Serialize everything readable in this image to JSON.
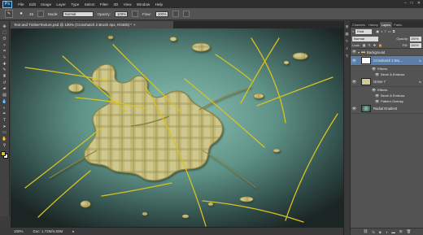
{
  "app": {
    "logo": "Ps"
  },
  "menu": [
    "File",
    "Edit",
    "Image",
    "Layer",
    "Type",
    "Select",
    "Filter",
    "3D",
    "View",
    "Window",
    "Help"
  ],
  "window_controls": [
    "–",
    "□",
    "✕"
  ],
  "options_bar": {
    "brush_size": "45",
    "mode_label": "Mode:",
    "mode_value": "Normal",
    "opacity_label": "Opacity:",
    "opacity_value": "100%",
    "flow_label": "Flow:",
    "flow_value": "100%"
  },
  "document": {
    "tab_title": "Text and TimberTexture.psd @ 100% (Crosshatch 2 Brush 4px, RGB/8) *",
    "close": "×",
    "zoom": "100%",
    "doc_size": "Doc: 1.72M/4.83M"
  },
  "colors": {
    "canvas_bg": "#5a8a82",
    "splatter": "#b8b06a",
    "lines": "#d8c220",
    "foreground_swatch": "#d8c220",
    "background_swatch": "#ffffff",
    "selection": "#5c7ea8"
  },
  "layers_panel": {
    "tabs": [
      "Channels",
      "History",
      "Layers",
      "Paths"
    ],
    "active_tab": "Layers",
    "filter_kind": "Kind",
    "blend_mode": "Normal",
    "opacity_label": "Opacity:",
    "opacity_value": "100%",
    "lock_label": "Lock:",
    "fill_label": "Fill:",
    "fill_value": "100%",
    "layers": [
      {
        "name": "Background",
        "type": "group"
      },
      {
        "name": "Crosshatch 2 Bru...",
        "selected": true,
        "fx": "fx",
        "effects_label": "Effects",
        "effects": [
          "Bevel & Emboss"
        ]
      },
      {
        "name": "Grime 7",
        "fx": "fx",
        "effects_label": "Effects",
        "effects": [
          "Bevel & Emboss",
          "Pattern Overlay"
        ]
      },
      {
        "name": "Radial Gradient"
      }
    ]
  },
  "icons": {
    "tools": [
      "move-icon",
      "marquee-icon",
      "lasso-icon",
      "quick-select-icon",
      "crop-icon",
      "eyedropper-icon",
      "healing-icon",
      "brush-icon",
      "clone-stamp-icon",
      "history-brush-icon",
      "eraser-icon",
      "gradient-icon",
      "blur-icon",
      "dodge-icon",
      "pen-icon",
      "type-icon",
      "path-select-icon",
      "shape-icon",
      "hand-icon",
      "zoom-icon"
    ]
  }
}
